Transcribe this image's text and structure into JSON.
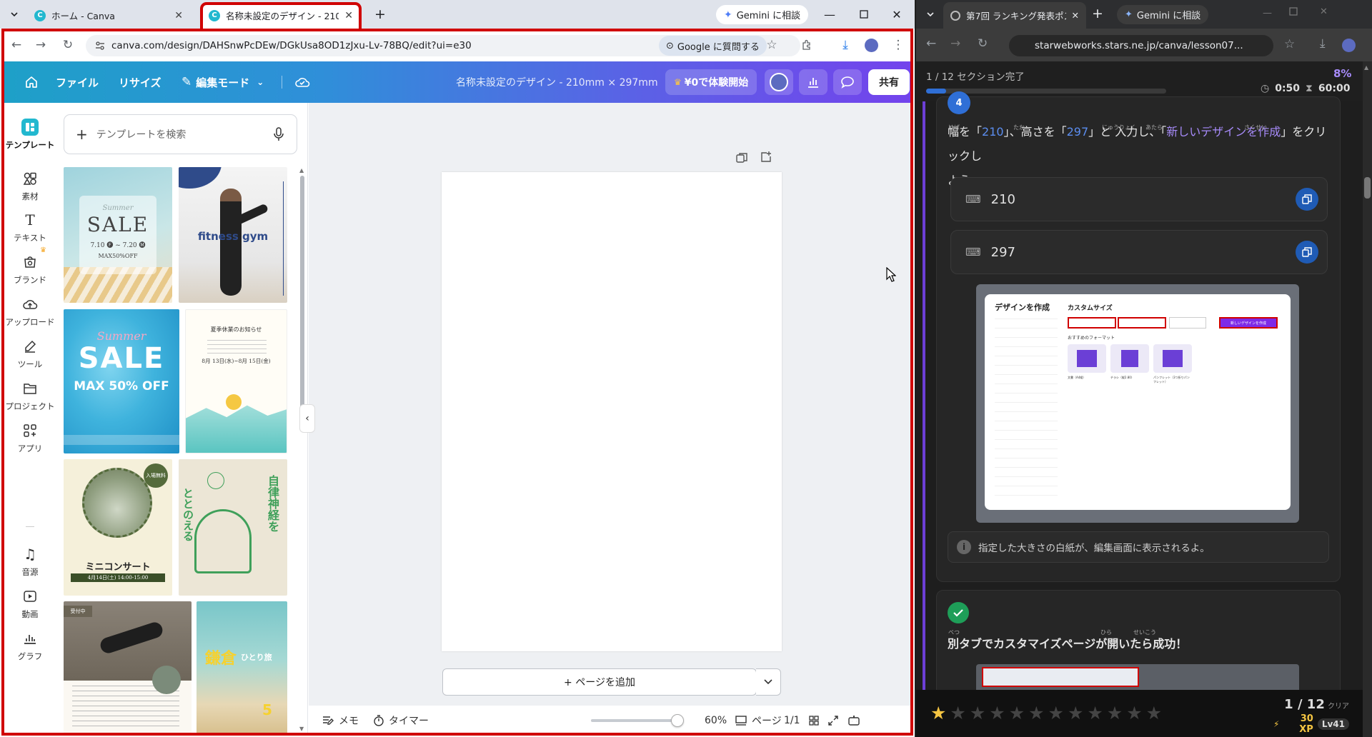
{
  "left_browser": {
    "tabs": [
      {
        "title": "ホーム - Canva",
        "active": false
      },
      {
        "title": "名称未設定のデザイン - 210 × 297",
        "active": true
      }
    ],
    "gemini_label": "Gemini に相談",
    "url": "canva.com/design/DAHSnwPcDEw/DGkUsa8OD1zJxu-Lv-78BQ/edit?ui=e30",
    "google_ask_label": "Google に質問する"
  },
  "canva": {
    "menu": {
      "file": "ファイル",
      "resize": "リサイズ",
      "edit_mode": "編集モード"
    },
    "doc_title": "名称未設定のデザイン - 210mm × 297mm",
    "trial_label": "¥0で体験開始",
    "share_label": "共有",
    "rail": [
      {
        "label": "テンプレート",
        "icon": "templates-icon"
      },
      {
        "label": "素材",
        "icon": "elements-icon"
      },
      {
        "label": "テキスト",
        "icon": "text-icon"
      },
      {
        "label": "ブランド",
        "icon": "brand-icon"
      },
      {
        "label": "アップロード",
        "icon": "upload-icon"
      },
      {
        "label": "ツール",
        "icon": "tools-icon"
      },
      {
        "label": "プロジェクト",
        "icon": "projects-icon"
      },
      {
        "label": "アプリ",
        "icon": "apps-icon"
      },
      {
        "label": "音源",
        "icon": "audio-icon"
      },
      {
        "label": "動画",
        "icon": "video-icon"
      },
      {
        "label": "グラフ",
        "icon": "chart-icon"
      }
    ],
    "search_placeholder": "テンプレートを検索",
    "templates": {
      "t1": {
        "line1": "Summer",
        "line2": "SALE",
        "line3": "7.10 🅕 ~ 7.20 🅜",
        "line4": "MAX50%OFF"
      },
      "t2": {
        "line1": "fitness gym"
      },
      "t3": {
        "line1": "Summer",
        "line2": "SALE",
        "line3": "MAX 50% OFF"
      },
      "t4": {
        "line1": "夏季休業のお知らせ",
        "line2": "8月 13日(水)~8月 15日(金)"
      },
      "t5": {
        "badge": "入場無料",
        "line1": "ミニコンサート",
        "line2": "4月14日(土) 14:00-15:00"
      },
      "t6": {
        "line1": "自律神経を",
        "line2": "ととのえる"
      },
      "t7": {
        "badge": "受付中"
      },
      "t8": {
        "line1": "鎌倉",
        "line2": "ひとり旅",
        "line3": "5"
      }
    },
    "add_page_label": "+ ページを追加",
    "footer": {
      "notes": "メモ",
      "timer": "タイマー",
      "zoom": "60%",
      "pages_label": "ページ",
      "page_count": "1/1",
      "zoom_value": 0.6
    }
  },
  "right_browser": {
    "tab_title": "第7回 ランキング発表ポスターを作",
    "gemini_label": "Gemini に相談",
    "url": "starwebworks.stars.ne.jp/canva/lesson07...",
    "progress_text": "1 / 12 セクション完了",
    "progress_percent": "8%",
    "progress_fraction": 0.083,
    "timer_elapsed": "0:50",
    "timer_total": "60:00",
    "instruction_pre": "幅を「",
    "instruction_w": "210",
    "instruction_mid": "」、高さを「",
    "instruction_h": "297",
    "instruction_mid2": "」と 入力し、「",
    "instruction_btn": "新しいデザインを作成",
    "instruction_post": "」をクリックし",
    "instruction_end": "よう",
    "ruby": {
      "haba": "はば",
      "taka": "たか",
      "nyuuryoku": "にゅうりょく",
      "atara": "あたら",
      "tsukuru": "さくせい"
    },
    "input_width": "210",
    "input_height": "297",
    "modal": {
      "title": "デザインを作成",
      "custom_size": "カスタムサイズ",
      "create_button": "新しいデザインを作成",
      "recommended": "おすすめのフォーマット",
      "formats": [
        "文書（A4縦）",
        "チラシ（縦2.80）",
        "パンフレット（3つ折りパンフレット）"
      ]
    },
    "note": "指定した大きさの白紙が、編集画面に表示されるよ。",
    "next_step": "別タブでカスタマイズページが開いたら成功！",
    "ruby_next": {
      "betsu": "べつ",
      "hira": "ひら",
      "seikou": "せいこう"
    },
    "stars_filled": 1,
    "stars_total": 12,
    "level_text": "1 / 12",
    "clear_label": "クリア",
    "xp": "30 XP",
    "level": "Lv41"
  }
}
